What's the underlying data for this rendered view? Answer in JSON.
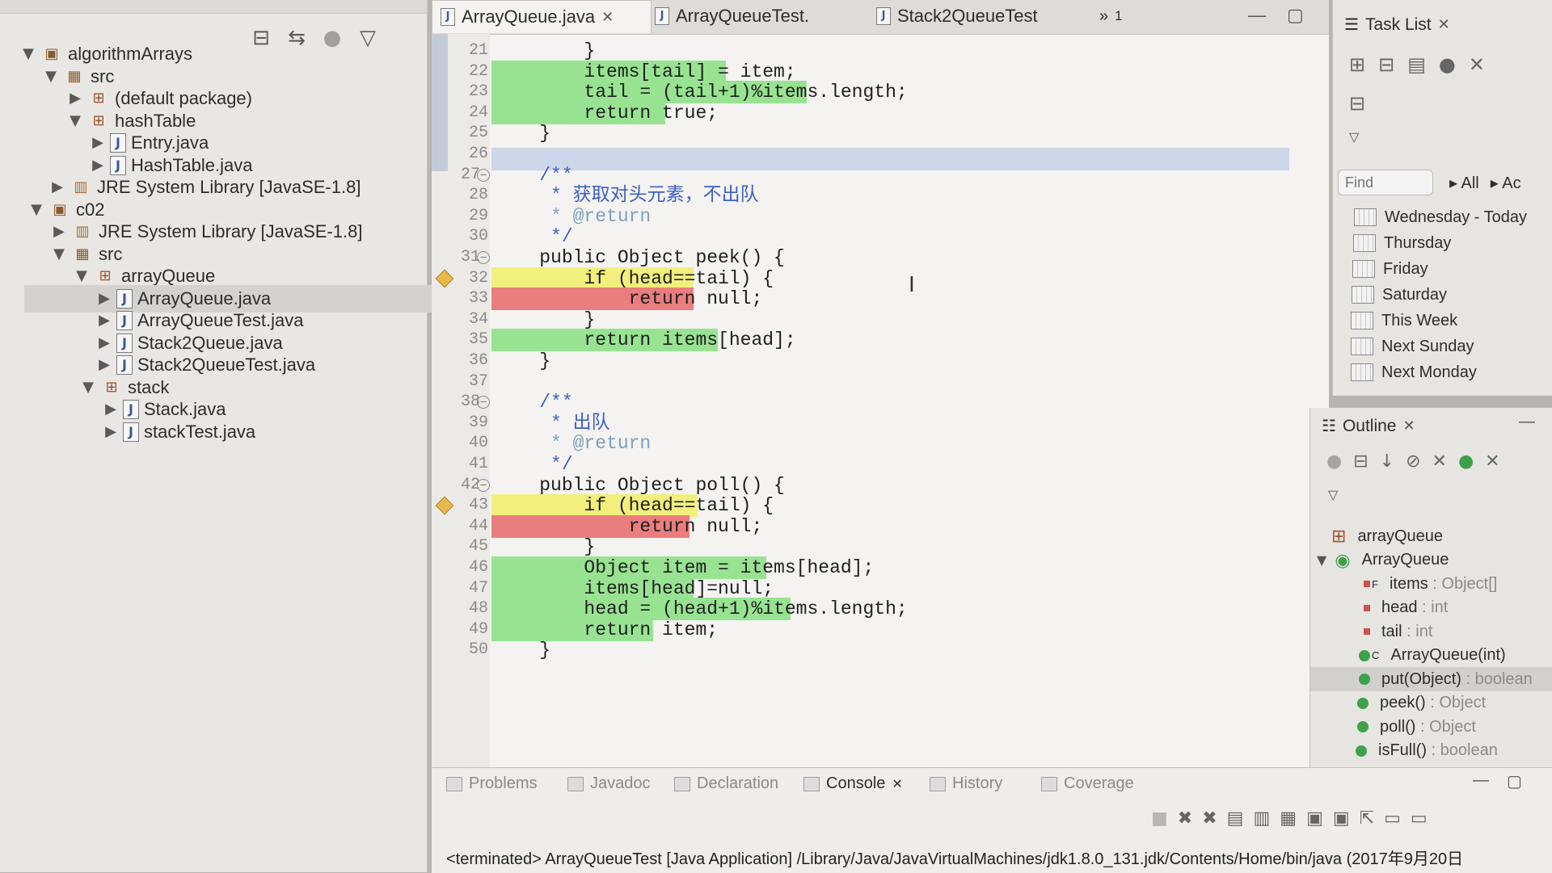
{
  "explorer": {
    "toolbar_icons": [
      "collapse-all-icon",
      "link-editor-icon",
      "focus-icon",
      "view-menu-icon"
    ],
    "tree": [
      {
        "label": "algorithmArrays",
        "kind": "project",
        "twisty": "open"
      },
      {
        "label": "src",
        "kind": "srcfolder",
        "twisty": "open"
      },
      {
        "label": "(default package)",
        "kind": "package",
        "twisty": "closed"
      },
      {
        "label": "hashTable",
        "kind": "package",
        "twisty": "open"
      },
      {
        "label": "Entry.java",
        "kind": "java",
        "twisty": "closed"
      },
      {
        "label": "HashTable.java",
        "kind": "java",
        "twisty": "closed"
      },
      {
        "label": "JRE System Library [JavaSE-1.8]",
        "kind": "library",
        "twisty": "closed"
      },
      {
        "label": "c02",
        "kind": "project",
        "twisty": "open"
      },
      {
        "label": "JRE System Library [JavaSE-1.8]",
        "kind": "library",
        "twisty": "closed"
      },
      {
        "label": "src",
        "kind": "srcfolder",
        "twisty": "open"
      },
      {
        "label": "arrayQueue",
        "kind": "package",
        "twisty": "open"
      },
      {
        "label": "ArrayQueue.java",
        "kind": "java",
        "twisty": "closed",
        "selected": true
      },
      {
        "label": "ArrayQueueTest.java",
        "kind": "java",
        "twisty": "closed"
      },
      {
        "label": "Stack2Queue.java",
        "kind": "java",
        "twisty": "closed"
      },
      {
        "label": "Stack2QueueTest.java",
        "kind": "java",
        "twisty": "closed"
      },
      {
        "label": "stack",
        "kind": "package",
        "twisty": "open"
      },
      {
        "label": "Stack.java",
        "kind": "java",
        "twisty": "closed"
      },
      {
        "label": "stackTest.java",
        "kind": "java",
        "twisty": "closed"
      }
    ]
  },
  "editor": {
    "tabs": [
      {
        "label": "ArrayQueue.java",
        "active": true
      },
      {
        "label": "ArrayQueueTest.",
        "active": false
      },
      {
        "label": "Stack2QueueTest",
        "active": false
      }
    ],
    "overflow_label": "»",
    "overflow_count": "1",
    "lines": [
      {
        "n": "21",
        "text": "        }"
      },
      {
        "n": "22",
        "text": "        items[tail] = item;",
        "hl": "g"
      },
      {
        "n": "23",
        "text": "        tail = (tail+1)%items.length;",
        "hl": "g"
      },
      {
        "n": "24",
        "text": "        return true;",
        "hl": "g"
      },
      {
        "n": "25",
        "text": "    }"
      },
      {
        "n": "26",
        "text": ""
      },
      {
        "n": "27",
        "text": "    /**",
        "fold": true
      },
      {
        "n": "28",
        "text": "     * 获取对头元素，不出队"
      },
      {
        "n": "29",
        "text": "     * @return"
      },
      {
        "n": "30",
        "text": "     */"
      },
      {
        "n": "31",
        "text": "    public Object peek() {",
        "fold": true
      },
      {
        "n": "32",
        "text": "        if (head==tail) {",
        "hl": "y",
        "warn": true
      },
      {
        "n": "33",
        "text": "            return null;",
        "hl": "r"
      },
      {
        "n": "34",
        "text": "        }"
      },
      {
        "n": "35",
        "text": "        return items[head];",
        "hl": "g"
      },
      {
        "n": "36",
        "text": "    }"
      },
      {
        "n": "37",
        "text": ""
      },
      {
        "n": "38",
        "text": "    /**",
        "fold": true
      },
      {
        "n": "39",
        "text": "     * 出队"
      },
      {
        "n": "40",
        "text": "     * @return"
      },
      {
        "n": "41",
        "text": "     */"
      },
      {
        "n": "42",
        "text": "    public Object poll() {",
        "fold": true
      },
      {
        "n": "43",
        "text": "        if (head==tail) {",
        "hl": "y",
        "warn": true
      },
      {
        "n": "44",
        "text": "            return null;",
        "hl": "r"
      },
      {
        "n": "45",
        "text": "        }"
      },
      {
        "n": "46",
        "text": "        Object item = items[head];",
        "hl": "g"
      },
      {
        "n": "47",
        "text": "        items[head]=null;",
        "hl": "g"
      },
      {
        "n": "48",
        "text": "        head = (head+1)%items.length;",
        "hl": "g"
      },
      {
        "n": "49",
        "text": "        return item;",
        "hl": "g"
      },
      {
        "n": "50",
        "text": "    }"
      }
    ]
  },
  "tasklist": {
    "title": "Task List",
    "find_placeholder": "Find",
    "filter_all": "All",
    "filter_ac": "Ac",
    "items": [
      "Wednesday - Today",
      "Thursday",
      "Friday",
      "Saturday",
      "This Week",
      "Next Sunday",
      "Next Monday"
    ]
  },
  "outline": {
    "title": "Outline",
    "items": [
      {
        "label": "arrayQueue",
        "sub": "",
        "kind": "package"
      },
      {
        "label": "ArrayQueue",
        "sub": "",
        "kind": "class",
        "twisty": "open"
      },
      {
        "label": "items",
        "sub": " : Object[]",
        "kind": "field",
        "mark": "F"
      },
      {
        "label": "head",
        "sub": " : int",
        "kind": "field"
      },
      {
        "label": "tail",
        "sub": " : int",
        "kind": "field"
      },
      {
        "label": "ArrayQueue(int)",
        "sub": "",
        "kind": "method",
        "mark": "C"
      },
      {
        "label": "put(Object)",
        "sub": " : boolean",
        "kind": "method",
        "selected": true
      },
      {
        "label": "peek()",
        "sub": " : Object",
        "kind": "method"
      },
      {
        "label": "poll()",
        "sub": " : Object",
        "kind": "method"
      },
      {
        "label": "isFull()",
        "sub": " : boolean",
        "kind": "method"
      }
    ]
  },
  "console": {
    "tabs": [
      "Problems",
      "Javadoc",
      "Declaration",
      "Console",
      "History",
      "Coverage"
    ],
    "active_tab": "Console",
    "status": "<terminated> ArrayQueueTest [Java Application] /Library/Java/JavaVirtualMachines/jdk1.8.0_131.jdk/Contents/Home/bin/java (2017年9月20日"
  }
}
